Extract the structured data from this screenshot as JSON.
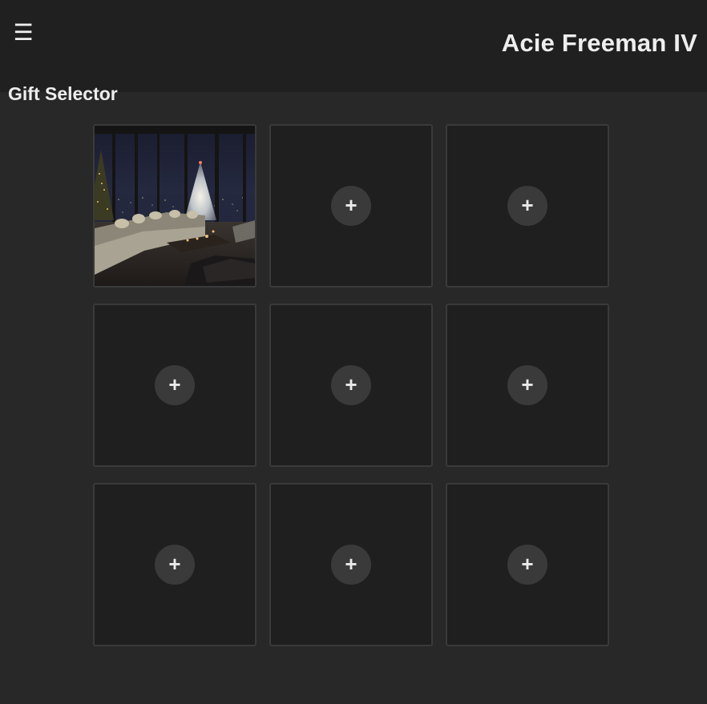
{
  "header": {
    "menu_icon_glyph": "☰",
    "user_name": "Acie Freeman IV"
  },
  "page": {
    "title": "Gift Selector"
  },
  "slots": [
    {
      "state": "image",
      "image_description_icon": "living-room-christmas-photo"
    },
    {
      "state": "empty",
      "add_glyph": "+"
    },
    {
      "state": "empty",
      "add_glyph": "+"
    },
    {
      "state": "empty",
      "add_glyph": "+"
    },
    {
      "state": "empty",
      "add_glyph": "+"
    },
    {
      "state": "empty",
      "add_glyph": "+"
    },
    {
      "state": "empty",
      "add_glyph": "+"
    },
    {
      "state": "empty",
      "add_glyph": "+"
    },
    {
      "state": "empty",
      "add_glyph": "+"
    }
  ],
  "colors": {
    "background": "#282828",
    "header_background": "#202020",
    "slot_background": "#1f1f1f",
    "slot_border": "#3a3a3a",
    "add_button": "#3a3a3a",
    "text": "#eeeeee"
  }
}
